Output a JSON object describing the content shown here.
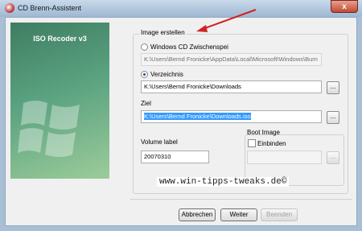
{
  "window": {
    "title": "CD Brenn-Assistent",
    "close_glyph": "x"
  },
  "banner": {
    "title": "ISO Recoder v3"
  },
  "image_group": {
    "title": "Image erstellen",
    "option_cache": {
      "label": "Windows CD Zwischenspei",
      "selected": false,
      "path": "K:\\Users\\Bernd Fronicke\\AppData\\Local\\Microsoft\\Windows\\Burn"
    },
    "option_folder": {
      "label": "Verzeichnis",
      "selected": true,
      "path": "K:\\Users\\Bernd Fronicke\\Downloads"
    },
    "target": {
      "label": "Ziel",
      "path": "K:\\Users\\Bernd Fronicke\\Downloads.iso"
    },
    "volume": {
      "label": "Volume label",
      "value": "20070310"
    },
    "boot": {
      "title": "Boot Image",
      "checkbox_label": "Einbinden",
      "checked": false,
      "path": ""
    },
    "browse_label": "..."
  },
  "watermark": "www.win-tipps-tweaks.de©",
  "buttons": {
    "cancel": "Abbrechen",
    "next": "Weiter",
    "finish": "Beenden"
  },
  "annotation": {
    "arrow_color": "#d42020"
  }
}
